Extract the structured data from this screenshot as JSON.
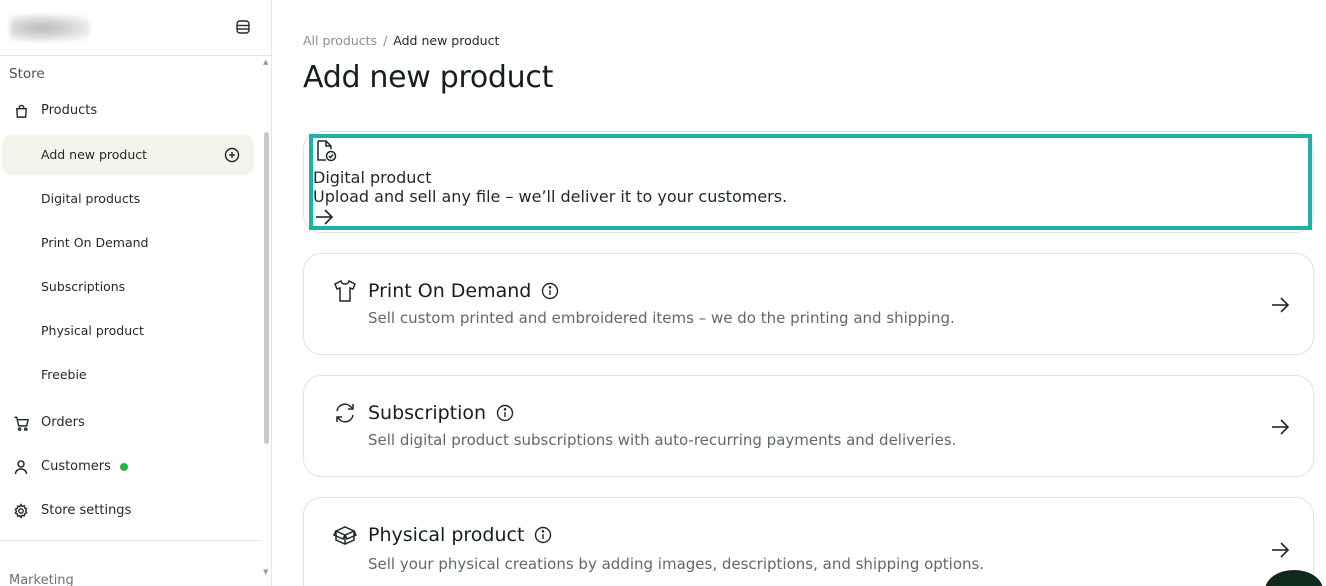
{
  "sidebar": {
    "section_label": "Store",
    "items": {
      "products": "Products",
      "add_new_product": "Add new product",
      "digital_products": "Digital products",
      "print_on_demand": "Print On Demand",
      "subscriptions": "Subscriptions",
      "physical_product": "Physical product",
      "freebie": "Freebie",
      "orders": "Orders",
      "customers": "Customers",
      "store_settings": "Store settings"
    },
    "next_section_label": "Marketing",
    "status_dot_color": "#27b24a"
  },
  "breadcrumb": {
    "parent": "All products",
    "separator": "/",
    "current": "Add new product"
  },
  "page_title": "Add new product",
  "cards": [
    {
      "title": "Digital product",
      "description": "Upload and sell any file – we’ll deliver it to your customers.",
      "icon": "digital-file-icon",
      "info": false,
      "highlighted": true
    },
    {
      "title": "Print On Demand",
      "description": "Sell custom printed and embroidered items – we do the printing and shipping.",
      "icon": "tshirt-icon",
      "info": true
    },
    {
      "title": "Subscription",
      "description": "Sell digital product subscriptions with auto-recurring payments and deliveries.",
      "icon": "refresh-icon",
      "info": true
    },
    {
      "title": "Physical product",
      "description": "Sell your physical creations by adding images, descriptions, and shipping options.",
      "icon": "box-icon",
      "info": true
    }
  ],
  "colors": {
    "highlight": "#1fb1a5",
    "active_nav_bg": "#f2f3ea",
    "fab": "#0f2a1c"
  }
}
